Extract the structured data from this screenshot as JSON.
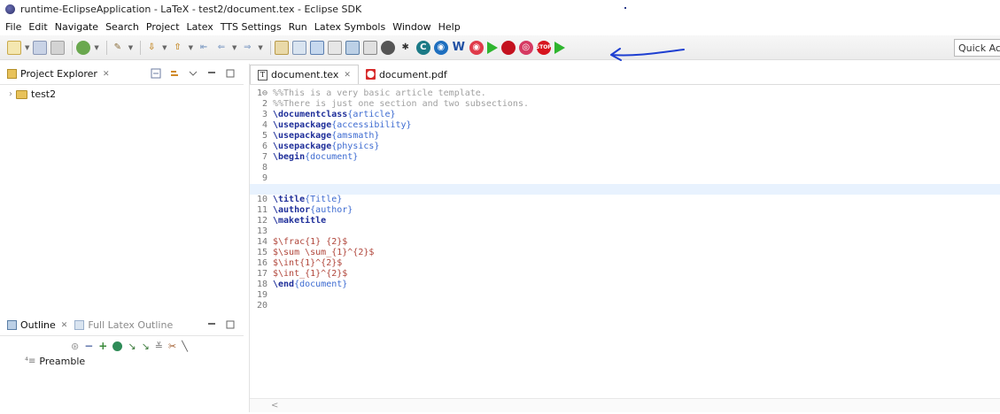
{
  "window": {
    "title": "runtime-EclipseApplication - LaTeX - test2/document.tex - Eclipse SDK"
  },
  "menu": [
    "File",
    "Edit",
    "Navigate",
    "Search",
    "Project",
    "Latex",
    "TTS Settings",
    "Run",
    "Latex Symbols",
    "Window",
    "Help"
  ],
  "toolbar": {
    "quick_access": "Quick Access",
    "annotation": "hand-drawn-arrow"
  },
  "project_explorer": {
    "title": "Project Explorer",
    "tree": [
      {
        "label": "test2",
        "icon": "project-folder-icon"
      }
    ]
  },
  "outline": {
    "tab_outline": "Outline",
    "tab_full": "Full Latex Outline",
    "items": [
      {
        "label": "Preamble"
      }
    ]
  },
  "editor": {
    "tabs": [
      {
        "label": "document.tex",
        "active": true
      },
      {
        "label": "document.pdf",
        "active": false
      }
    ],
    "current_line": 9,
    "scroll_left": "<"
  },
  "colors": {
    "accent_green": "#2fb52f",
    "accent_red": "#d72a2a",
    "current_line": "#e8f2fe",
    "latex_command": "#1f2f9a",
    "latex_argument": "#3d6bd1",
    "math_text": "#b0453a",
    "comment": "#a0a0a0"
  }
}
